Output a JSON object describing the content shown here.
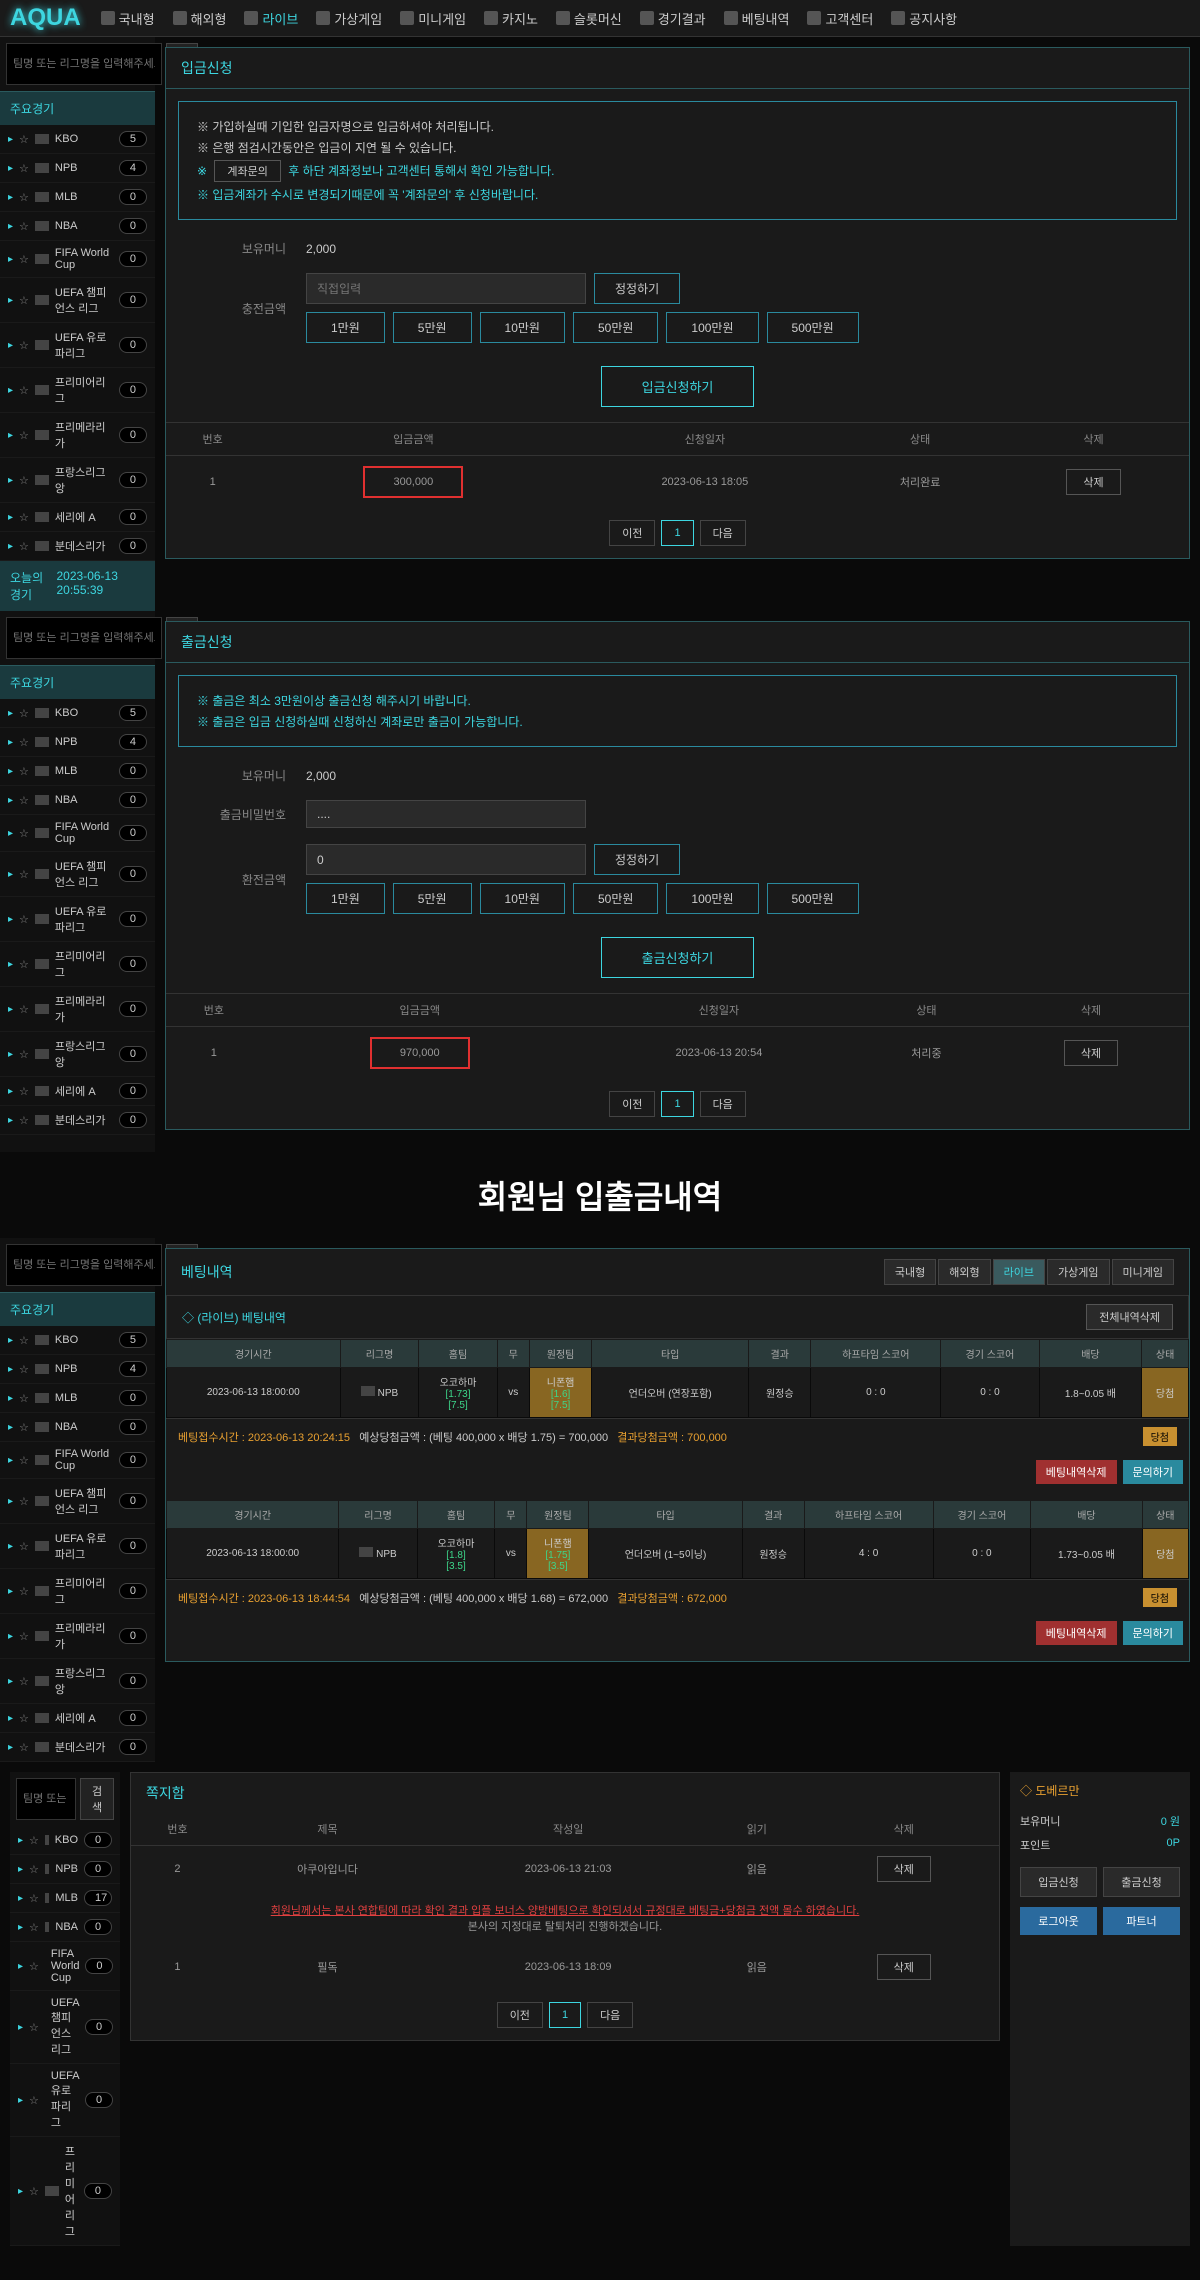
{
  "logo": "AQUA",
  "nav": [
    "국내형",
    "해외형",
    "라이브",
    "가상게임",
    "미니게임",
    "카지노",
    "슬롯머신",
    "경기결과",
    "베팅내역",
    "고객센터",
    "공지사항"
  ],
  "nav_active": 2,
  "search": {
    "placeholder": "팀명 또는 리그명을 입력해주세요.",
    "btn": "검색"
  },
  "sidebar": {
    "header": "주요경기",
    "today_label": "오늘의 경기",
    "today_time": "2023-06-13 20:55:39",
    "leagues": [
      {
        "name": "KBO",
        "count": "5"
      },
      {
        "name": "NPB",
        "count": "4"
      },
      {
        "name": "MLB",
        "count": "0"
      },
      {
        "name": "NBA",
        "count": "0"
      },
      {
        "name": "FIFA World Cup",
        "count": "0"
      },
      {
        "name": "UEFA 챔피언스 리그",
        "count": "0"
      },
      {
        "name": "UEFA 유로파리그",
        "count": "0"
      },
      {
        "name": "프리미어리그",
        "count": "0"
      },
      {
        "name": "프리메라리가",
        "count": "0"
      },
      {
        "name": "프랑스리그앙",
        "count": "0"
      },
      {
        "name": "세리에 A",
        "count": "0"
      },
      {
        "name": "분데스리가",
        "count": "0"
      }
    ],
    "leagues3": [
      {
        "name": "KBO",
        "count": "0"
      },
      {
        "name": "NPB",
        "count": "0"
      },
      {
        "name": "MLB",
        "count": "17"
      },
      {
        "name": "NBA",
        "count": "0"
      },
      {
        "name": "FIFA World Cup",
        "count": "0"
      },
      {
        "name": "UEFA 챔피언스 리그",
        "count": "0"
      },
      {
        "name": "UEFA 유로파리그",
        "count": "0"
      },
      {
        "name": "프리미어리그",
        "count": "0"
      }
    ]
  },
  "deposit": {
    "title": "입금신청",
    "notices": [
      "※ 가입하실때 기입한 입금자명으로 입금하셔야 처리됩니다.",
      "※ 은행 점검시간동안은 입금이 지연 될 수 있습니다.",
      "※ 입금계좌가 수시로 변경되기때문에 꼭 '계좌문의' 후 신청바랍니다."
    ],
    "notice_inline_btn": "계좌문의",
    "notice_inline": "후 하단 계좌정보나 고객센터 통해서 확인 가능합니다.",
    "balance_label": "보유머니",
    "balance": "2,000",
    "amount_label": "충전금액",
    "direct_placeholder": "직접입력",
    "correct_btn": "정정하기",
    "amount_btns": [
      "1만원",
      "5만원",
      "10만원",
      "50만원",
      "100만원",
      "500만원"
    ],
    "submit": "입금신청하기",
    "table_headers": [
      "번호",
      "입금금액",
      "신청일자",
      "상태",
      "삭제"
    ],
    "rows": [
      {
        "no": "1",
        "amount": "300,000",
        "date": "2023-06-13 18:05",
        "status": "처리완료",
        "del": "삭제"
      }
    ]
  },
  "withdraw": {
    "title": "출금신청",
    "notices": [
      "※ 출금은 최소 3만원이상 출금신청 해주시기 바랍니다.",
      "※ 출금은 입금 신청하실때 신청하신 계좌로만 출금이 가능합니다."
    ],
    "balance_label": "보유머니",
    "balance": "2,000",
    "pw_label": "출금비밀번호",
    "pw_value": "....",
    "amount_label": "환전금액",
    "amount_value": "0",
    "correct_btn": "정정하기",
    "amount_btns": [
      "1만원",
      "5만원",
      "10만원",
      "50만원",
      "100만원",
      "500만원"
    ],
    "submit": "출금신청하기",
    "table_headers": [
      "번호",
      "입금금액",
      "신청일자",
      "상태",
      "삭제"
    ],
    "rows": [
      {
        "no": "1",
        "amount": "970,000",
        "date": "2023-06-13 20:54",
        "status": "처리중",
        "del": "삭제"
      }
    ]
  },
  "pager": {
    "prev": "이전",
    "page": "1",
    "next": "다음"
  },
  "big_title": "회원님 입출금내역",
  "betting": {
    "title": "베팅내역",
    "tabs": [
      "국내형",
      "해외형",
      "라이브",
      "가상게임",
      "미니게임"
    ],
    "tab_active": 2,
    "sub_title": "◇ (라이브) 베팅내역",
    "del_all": "전체내역삭제",
    "headers": [
      "경기시간",
      "리그명",
      "홈팀",
      "무",
      "원정팀",
      "타입",
      "결과",
      "하프타임 스코어",
      "경기 스코어",
      "배당",
      "상태"
    ],
    "bets": [
      {
        "time": "2023-06-13 18:00:00",
        "league": "NPB",
        "home": "오코하마",
        "home_odds1": "[1.73]",
        "home_odds2": "[7.5]",
        "vs": "vs",
        "away": "니폰햄",
        "away_odds1": "[1.6]",
        "away_odds2": "[7.5]",
        "type": "언더오버 (연장포함)",
        "result": "원정승",
        "half": "0 : 0",
        "full": "0 : 0",
        "odds": "1.8~0.05 배",
        "status": "당첨",
        "summary_time": "베팅접수시간 : 2023-06-13 20:24:15",
        "summary_est": "예상당첨금액 : (베팅 400,000 x 배당 1.75) = 700,000",
        "summary_result": "결과당첨금액 : 700,000",
        "badge": "당첨"
      },
      {
        "time": "2023-06-13 18:00:00",
        "league": "NPB",
        "home": "오코하마",
        "home_odds1": "[1.8]",
        "home_odds2": "[3.5]",
        "vs": "vs",
        "away": "니폰햄",
        "away_odds1": "[1.75]",
        "away_odds2": "[3.5]",
        "type": "언더오버 (1~5이닝)",
        "result": "원정승",
        "half": "4 : 0",
        "full": "0 : 0",
        "odds": "1.73~0.05 배",
        "status": "당첨",
        "summary_time": "베팅접수시간 : 2023-06-13 18:44:54",
        "summary_est": "예상당첨금액 : (베팅 400,000 x 배당 1.68) = 672,000",
        "summary_result": "결과당첨금액 : 672,000",
        "badge": "당첨"
      }
    ],
    "bet_del": "베팅내역삭제",
    "inquiry": "문의하기"
  },
  "messages": {
    "title": "쪽지함",
    "headers": [
      "번호",
      "제목",
      "작성일",
      "읽기",
      "삭제"
    ],
    "rows": [
      {
        "no": "2",
        "title": "아쿠아입니다",
        "date": "2023-06-13 21:03",
        "read": "읽음",
        "del": "삭제"
      },
      {
        "no": "",
        "title": "회원님께서는 본사 연합팀에 따라 확인 결과 입플 보너스 양방베팅으로 확인되셔서 규정대로 베팅금+당첨금 전액 몰수 하였습니다.",
        "sub": "본사의 지정대로 탈퇴처리 진행하겠습니다.",
        "date": "",
        "read": "",
        "del": ""
      },
      {
        "no": "1",
        "title": "필독",
        "date": "2023-06-13 18:09",
        "read": "읽음",
        "del": "삭제"
      }
    ]
  },
  "right_panel": {
    "title": "◇ 도베르만",
    "balance_label": "보유머니",
    "balance_val": "0 원",
    "point_label": "포인트",
    "point_val": "0P",
    "deposit_btn": "입금신청",
    "withdraw_btn": "출금신청",
    "logout": "로그아웃",
    "charge": "파트너"
  }
}
